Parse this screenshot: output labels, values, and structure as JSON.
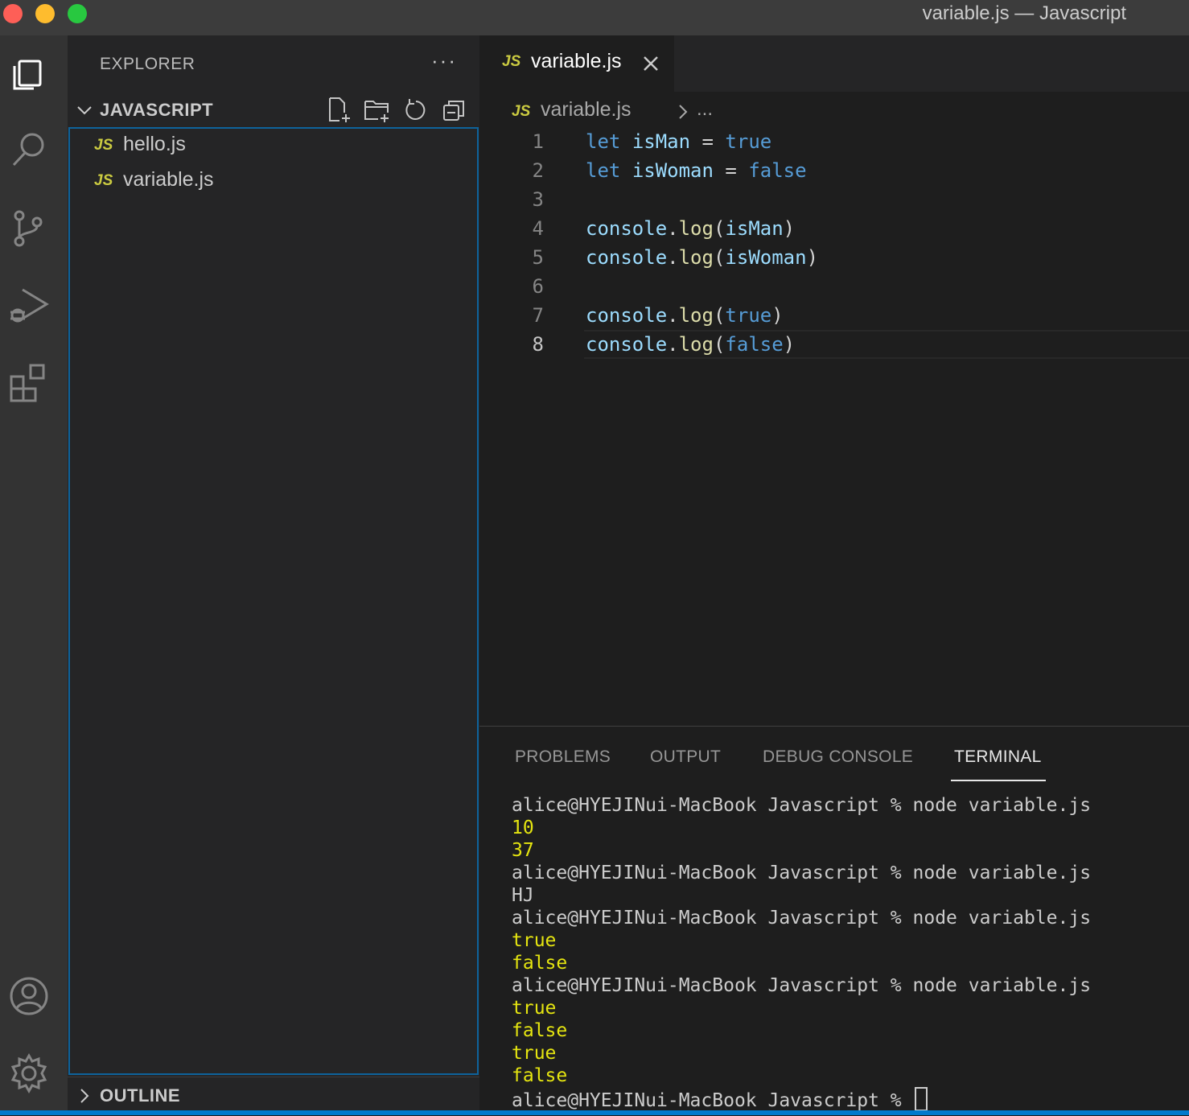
{
  "window": {
    "title": "variable.js — Javascript"
  },
  "activity_bar": [
    "files-icon",
    "search-icon",
    "source-control-icon",
    "run-debug-icon",
    "extensions-icon",
    "account-icon",
    "gear-icon"
  ],
  "sidebar": {
    "title": "EXPLORER",
    "more": "···",
    "section": "JAVASCRIPT",
    "files": [
      {
        "badge": "JS",
        "name": "hello.js"
      },
      {
        "badge": "JS",
        "name": "variable.js"
      }
    ],
    "outline": "OUTLINE"
  },
  "editor": {
    "tab": {
      "badge": "JS",
      "label": "variable.js"
    },
    "breadcrumb": {
      "badge": "JS",
      "file": "variable.js",
      "more": "..."
    },
    "current_line": 8,
    "lines": [
      {
        "n": "1",
        "tokens": [
          [
            "kw",
            "let"
          ],
          [
            "op",
            " "
          ],
          [
            "var",
            "isMan"
          ],
          [
            "op",
            " = "
          ],
          [
            "kw",
            "true"
          ]
        ]
      },
      {
        "n": "2",
        "tokens": [
          [
            "kw",
            "let"
          ],
          [
            "op",
            " "
          ],
          [
            "var",
            "isWoman"
          ],
          [
            "op",
            " = "
          ],
          [
            "kw",
            "false"
          ]
        ]
      },
      {
        "n": "3",
        "tokens": []
      },
      {
        "n": "4",
        "tokens": [
          [
            "var",
            "console"
          ],
          [
            "op",
            "."
          ],
          [
            "fn",
            "log"
          ],
          [
            "op",
            "("
          ],
          [
            "var",
            "isMan"
          ],
          [
            "op",
            ")"
          ]
        ]
      },
      {
        "n": "5",
        "tokens": [
          [
            "var",
            "console"
          ],
          [
            "op",
            "."
          ],
          [
            "fn",
            "log"
          ],
          [
            "op",
            "("
          ],
          [
            "var",
            "isWoman"
          ],
          [
            "op",
            ")"
          ]
        ]
      },
      {
        "n": "6",
        "tokens": []
      },
      {
        "n": "7",
        "tokens": [
          [
            "var",
            "console"
          ],
          [
            "op",
            "."
          ],
          [
            "fn",
            "log"
          ],
          [
            "op",
            "("
          ],
          [
            "kw",
            "true"
          ],
          [
            "op",
            ")"
          ]
        ]
      },
      {
        "n": "8",
        "tokens": [
          [
            "var",
            "console"
          ],
          [
            "op",
            "."
          ],
          [
            "fn",
            "log"
          ],
          [
            "op",
            "("
          ],
          [
            "kw",
            "false"
          ],
          [
            "op",
            ")"
          ]
        ]
      }
    ]
  },
  "panel": {
    "tabs": [
      "PROBLEMS",
      "OUTPUT",
      "DEBUG CONSOLE",
      "TERMINAL"
    ],
    "active_tab": "TERMINAL",
    "terminal": [
      {
        "type": "cmd",
        "text": "alice@HYEJINui-MacBook Javascript % node variable.js"
      },
      {
        "type": "out",
        "text": "10"
      },
      {
        "type": "out",
        "text": "37"
      },
      {
        "type": "cmd",
        "text": "alice@HYEJINui-MacBook Javascript % node variable.js"
      },
      {
        "type": "plain",
        "text": "HJ"
      },
      {
        "type": "cmd",
        "text": "alice@HYEJINui-MacBook Javascript % node variable.js"
      },
      {
        "type": "out",
        "text": "true"
      },
      {
        "type": "out",
        "text": "false"
      },
      {
        "type": "cmd",
        "text": "alice@HYEJINui-MacBook Javascript % node variable.js"
      },
      {
        "type": "out",
        "text": "true"
      },
      {
        "type": "out",
        "text": "false"
      },
      {
        "type": "out",
        "text": "true"
      },
      {
        "type": "out",
        "text": "false"
      }
    ],
    "prompt": "alice@HYEJINui-MacBook Javascript % "
  },
  "colors": {
    "accent": "#007acc",
    "keyword": "#569cd6",
    "variable": "#9cdcfe",
    "function": "#dcdcaa",
    "js_badge": "#cbcb41",
    "terminal_output": "#e5e510"
  }
}
